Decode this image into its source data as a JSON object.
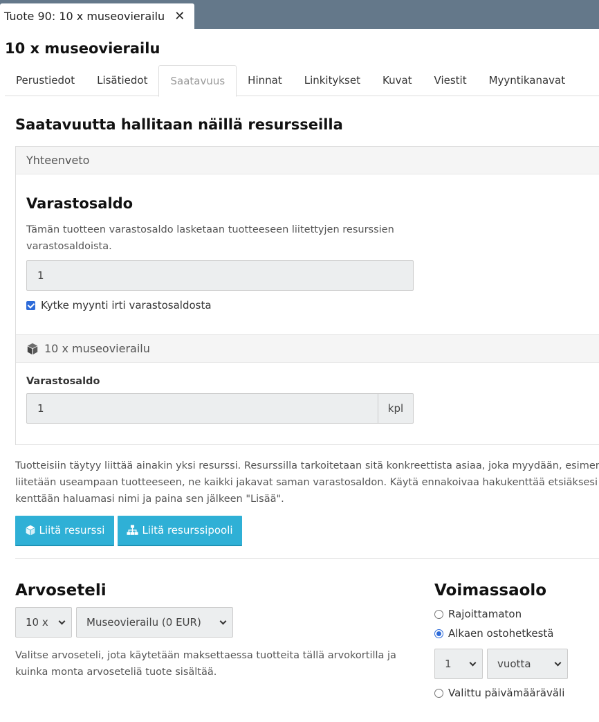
{
  "window": {
    "tab_title": "Tuote 90: 10 x museovierailu",
    "close_glyph": "✕"
  },
  "page_title": "10 x museovierailu",
  "tabs": [
    {
      "label": "Perustiedot",
      "active": false
    },
    {
      "label": "Lisätiedot",
      "active": false
    },
    {
      "label": "Saatavuus",
      "active": true
    },
    {
      "label": "Hinnat",
      "active": false
    },
    {
      "label": "Linkitykset",
      "active": false
    },
    {
      "label": "Kuvat",
      "active": false
    },
    {
      "label": "Viestit",
      "active": false
    },
    {
      "label": "Myyntikanavat",
      "active": false
    }
  ],
  "availability": {
    "title": "Saatavuutta hallitaan näillä resursseilla",
    "summary_heading": "Yhteenveto",
    "stock_title": "Varastosaldo",
    "stock_description": "Tämän tuotteen varastosaldo lasketaan tuotteeseen liitettyjen resurssien varastosaldoista.",
    "stock_value": "1",
    "decouple_label": "Kytke myynti irti varastosaldosta",
    "decouple_checked": true,
    "resource_name": "10 x museovierailu",
    "resource_icon": "cube-icon",
    "resource_stock_label": "Varastosaldo",
    "resource_stock_value": "1",
    "resource_stock_unit": "kpl"
  },
  "help": {
    "line1": "Tuotteisiin täytyy liittää ainakin yksi resurssi. Resurssilla tarkoitetaan sitä konkreettista asiaa, joka myydään, esimerk",
    "line2": "liitetään useampaan tuotteeseen, ne kaikki jakavat saman varastosaldon. Käytä ennakoivaa hakukenttää etsiäksesi re",
    "line3": "kenttään haluamasi nimi ja paina sen jälkeen \"Lisää\"."
  },
  "buttons": {
    "attach_resource": "Liitä resurssi",
    "attach_resource_pool": "Liitä resurssipooli"
  },
  "voucher": {
    "title": "Arvoseteli",
    "count_selected": "10 x",
    "voucher_selected": "Museovierailu (0 EUR)",
    "help": "Valitse arvoseteli, jota käytetään maksettaessa tuotteita tällä arvokortilla ja kuinka monta arvoseteliä tuote sisältää."
  },
  "validity": {
    "title": "Voimassaolo",
    "options": [
      {
        "label": "Rajoittamaton",
        "checked": false
      },
      {
        "label": "Alkaen ostohetkestä",
        "checked": true
      },
      {
        "label": "Valittu päivämääräväli",
        "checked": false
      }
    ],
    "amount_selected": "1",
    "unit_selected": "vuotta"
  },
  "colors": {
    "topbar": "#64788a",
    "button": "#2fb0d6",
    "checkbox": "#2d6bd9"
  }
}
